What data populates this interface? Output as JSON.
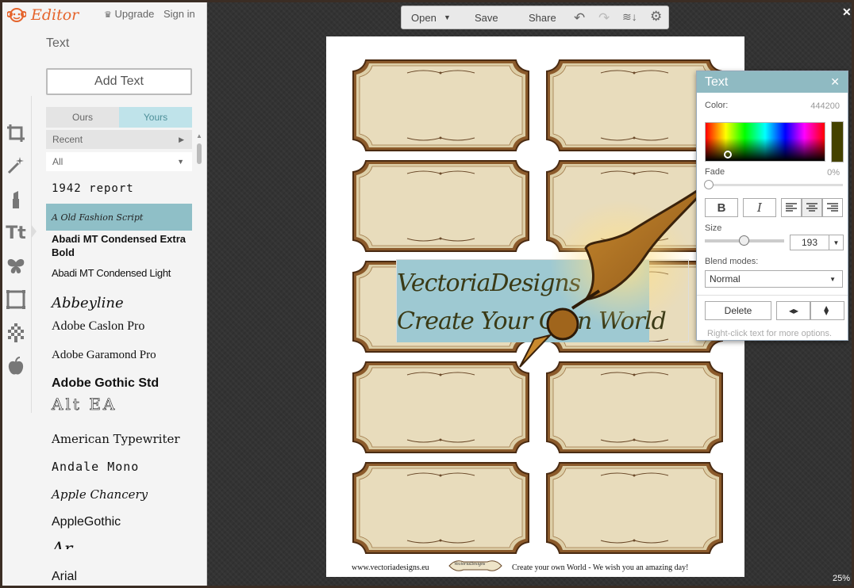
{
  "app": {
    "logo_text": "Editor",
    "upgrade_label": "Upgrade",
    "signin_label": "Sign in"
  },
  "sidebar": {
    "section_title": "Text",
    "add_text_label": "Add Text",
    "tabs": [
      {
        "label": "Ours",
        "active": false
      },
      {
        "label": "Yours",
        "active": true
      }
    ],
    "recent_label": "Recent",
    "filter_label": "All",
    "fonts": [
      {
        "label": "1942 report",
        "selected": false
      },
      {
        "label": "A Old Fashion Script",
        "selected": true
      },
      {
        "label": "Abadi MT Condensed Extra Bold",
        "selected": false
      },
      {
        "label": "Abadi MT Condensed Light",
        "selected": false
      },
      {
        "label": "Abbeyline",
        "selected": false
      },
      {
        "label": "Adobe Caslon Pro",
        "selected": false
      },
      {
        "label": "Adobe Garamond Pro",
        "selected": false
      },
      {
        "label": "Adobe Gothic Std",
        "selected": false
      },
      {
        "label": "Alt EA",
        "selected": false
      },
      {
        "label": "American Typewriter",
        "selected": false
      },
      {
        "label": "Andale Mono",
        "selected": false
      },
      {
        "label": "Apple Chancery",
        "selected": false
      },
      {
        "label": "AppleGothic",
        "selected": false
      },
      {
        "label": "Arial",
        "selected": false
      }
    ],
    "tools": [
      "crop-icon",
      "magic-wand-icon",
      "lipstick-icon",
      "text-icon",
      "butterfly-icon",
      "frame-icon",
      "texture-icon",
      "apple-icon"
    ]
  },
  "toolbar": {
    "open_label": "Open",
    "save_label": "Save",
    "share_label": "Share"
  },
  "canvas": {
    "zoom": "25%",
    "text_line1": "VectoriaDesigns",
    "text_line2": "Create Your Own World",
    "footer_url": "www.vectoriadesigns.eu",
    "footer_logo_text": "VectoriaDesigns",
    "footer_tagline": "Create your own World - We wish you an amazing day!",
    "label_count": 10
  },
  "text_panel": {
    "title": "Text",
    "color_label": "Color:",
    "color_value": "444200",
    "swatch_color": "#444200",
    "fade_label": "Fade",
    "fade_value": "0%",
    "bold_label": "B",
    "italic_label": "I",
    "size_label": "Size",
    "size_value": "193",
    "blend_label": "Blend modes:",
    "blend_value": "Normal",
    "delete_label": "Delete",
    "hint": "Right-click text for more options."
  }
}
